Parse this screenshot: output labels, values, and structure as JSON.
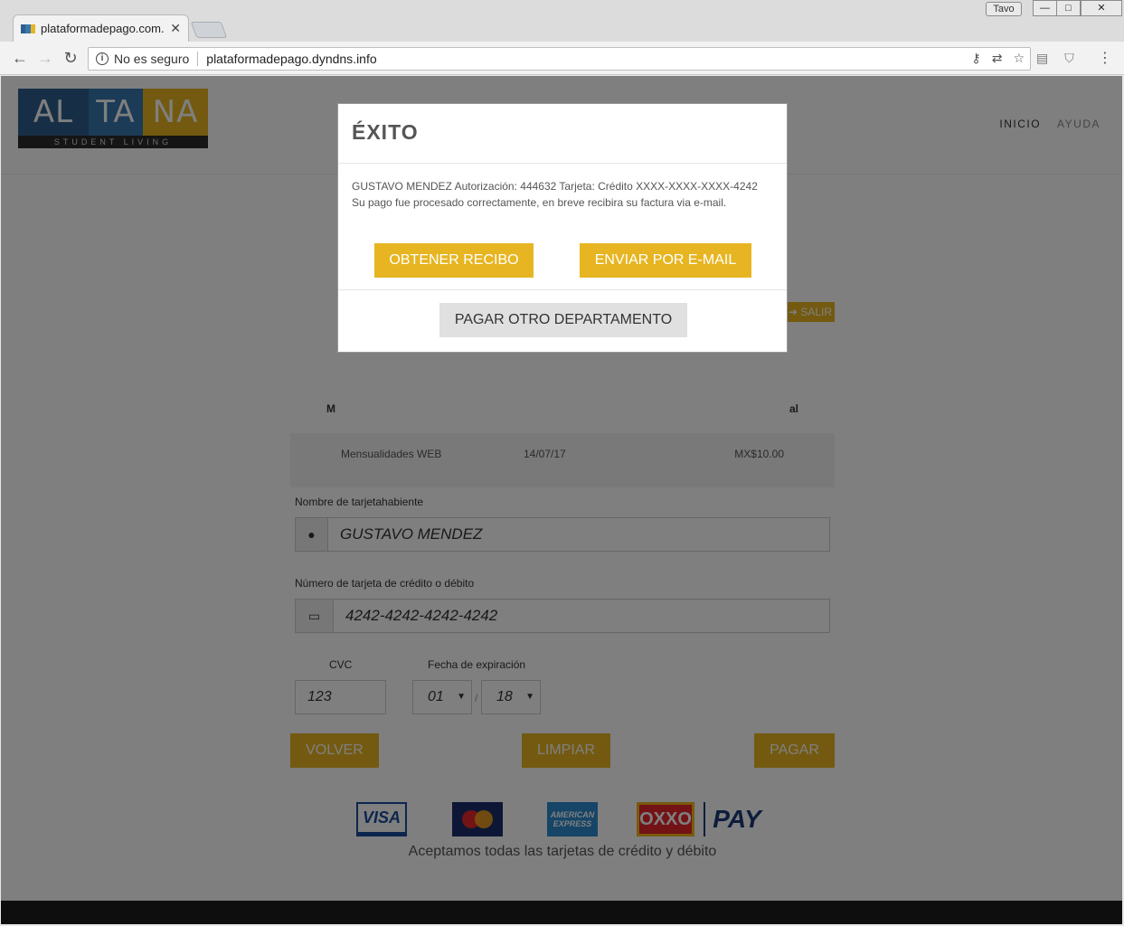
{
  "browser": {
    "tab_title": "plataformadepago.com.",
    "profile_name": "Tavo",
    "security_label": "No es seguro",
    "url": "plataformadepago.dyndns.info",
    "window_buttons": {
      "minimize": "—",
      "maximize": "□",
      "close": "✕"
    }
  },
  "logo": {
    "part1": "AL",
    "part2": "TA",
    "part3": "NA",
    "tagline": "STUDENT LIVING"
  },
  "nav": {
    "home": "INICIO",
    "help": "AYUDA"
  },
  "page": {
    "logout_label": "SALIR",
    "table": {
      "header_first": "M",
      "header_last": "al",
      "row": {
        "concept": "Mensualidades WEB",
        "date": "14/07/17",
        "total": "MX$10.00"
      }
    },
    "form": {
      "name_label": "Nombre de tarjetahabiente",
      "name_value": "GUSTAVO MENDEZ",
      "card_label": "Número de tarjeta de crédito o débito",
      "card_value": "4242-4242-4242-4242",
      "cvc_label": "CVC",
      "cvc_value": "123",
      "expiry_label": "Fecha de expiración",
      "expiry_month": "01",
      "expiry_separator": "/",
      "expiry_year": "18"
    },
    "buttons": {
      "back": "VOLVER",
      "clear": "LIMPIAR",
      "pay": "PAGAR"
    },
    "cards": {
      "visa": "VISA",
      "mastercard": "MasterCard",
      "amex": "AMERICAN EXPRESS",
      "oxxo": "OXXO",
      "pay": "PAY"
    },
    "cards_caption": "Aceptamos todas las tarjetas de crédito y débito"
  },
  "modal": {
    "title": "ÉXITO",
    "line1": "GUSTAVO MENDEZ Autorización: 444632 Tarjeta: Crédito XXXX-XXXX-XXXX-4242",
    "line2": "Su pago fue procesado correctamente, en breve recibira su factura via e-mail.",
    "receipt_button": "OBTENER RECIBO",
    "email_button": "ENVIAR POR E-MAIL",
    "pay_other_button": "PAGAR OTRO DEPARTAMENTO"
  },
  "colors": {
    "accent": "#e7b521",
    "logo_blue": "#2f5e8d",
    "overlay": "rgba(0,0,0,0.5)"
  }
}
